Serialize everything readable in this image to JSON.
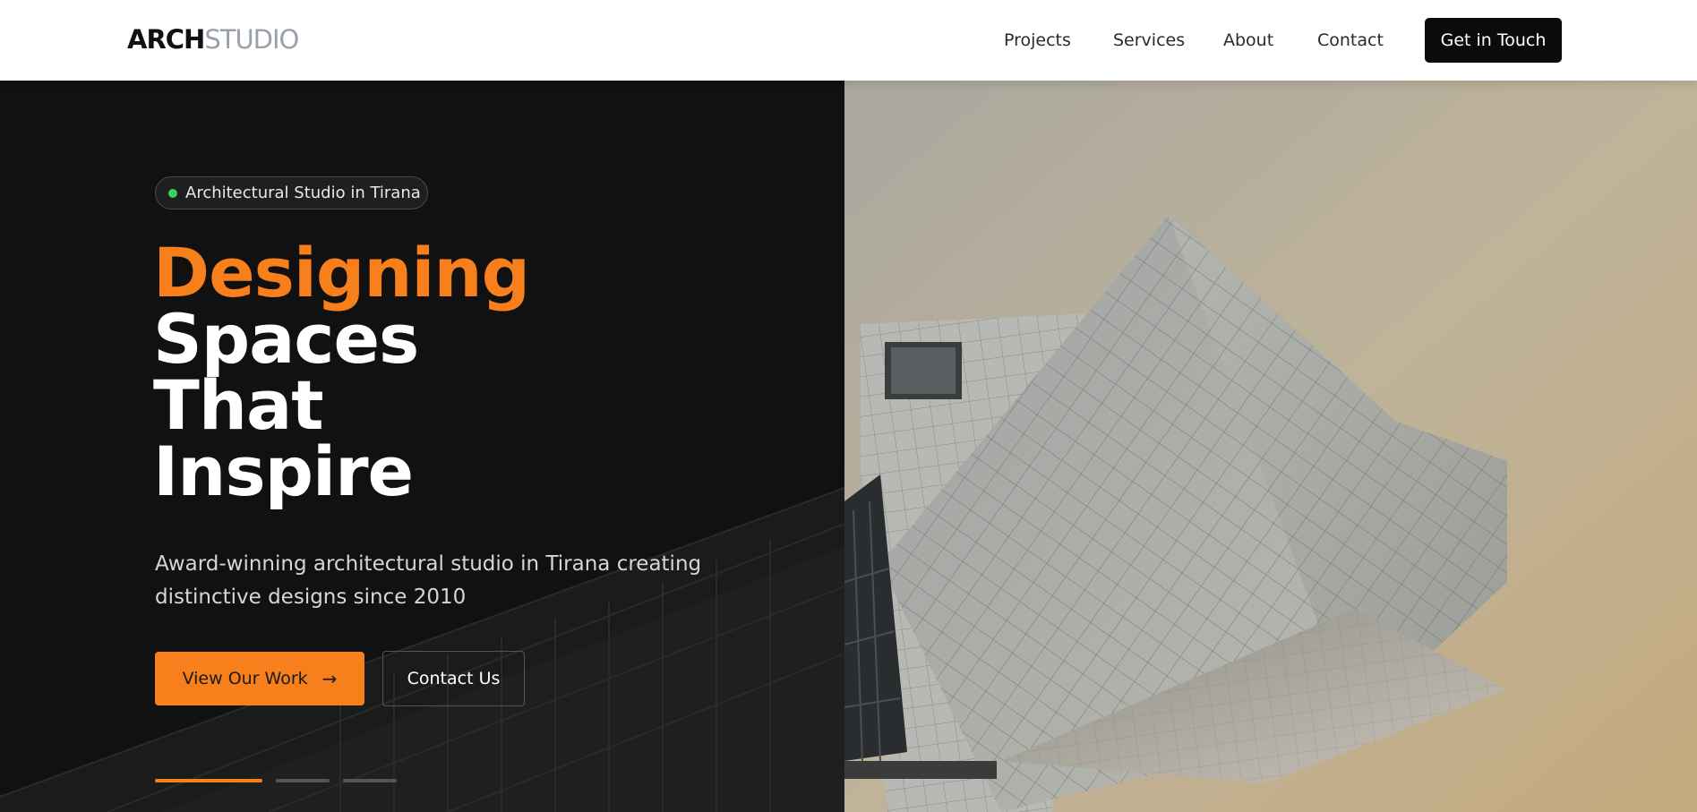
{
  "header": {
    "logo_part1": "ARCH",
    "logo_part2": "STUDIO",
    "nav": [
      {
        "label": "Projects"
      },
      {
        "label": "Services"
      },
      {
        "label": "About"
      },
      {
        "label": "Contact"
      }
    ],
    "cta_label": "Get in Touch"
  },
  "hero": {
    "badge": "Architectural Studio in Tirana",
    "headline": [
      "Designing",
      "Spaces",
      "That",
      "Inspire"
    ],
    "subtitle": "Award-winning architectural studio in Tirana creating distinctive designs since 2010",
    "primary_button": "View Our Work",
    "secondary_button": "Contact Us",
    "slides_total": 3,
    "active_slide": 1
  },
  "colors": {
    "accent": "#f77f1c",
    "dark_panel": "#121212",
    "status_dot": "#3ecf5a"
  },
  "icons": {
    "arrow": "arrow-right-icon",
    "badge_dot": "status-dot-icon"
  }
}
